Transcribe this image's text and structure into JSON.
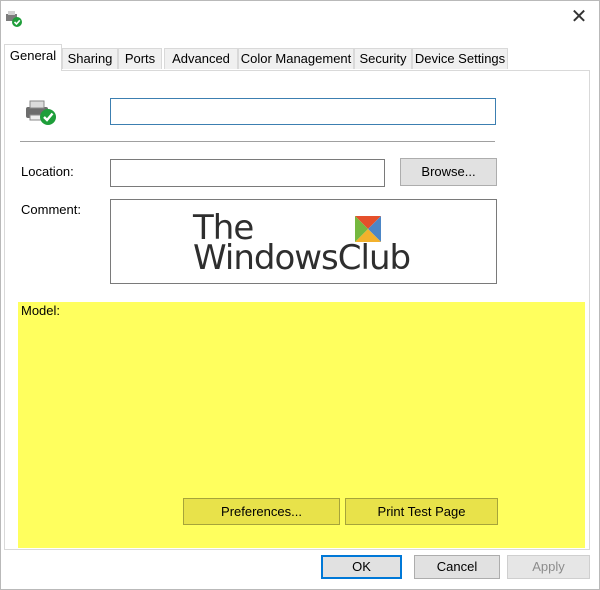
{
  "dialog": {
    "close_symbol": "✕"
  },
  "tabs": [
    {
      "label": "General",
      "active": true
    },
    {
      "label": "Sharing"
    },
    {
      "label": "Ports"
    },
    {
      "label": "Advanced"
    },
    {
      "label": "Color Management"
    },
    {
      "label": "Security"
    },
    {
      "label": "Device Settings"
    }
  ],
  "general": {
    "printer_name_value": "",
    "location_label": "Location:",
    "location_value": "",
    "browse_label": "Browse...",
    "comment_label": "Comment:",
    "comment_logo_line1": "The",
    "comment_logo_line2": "WindowsClub",
    "model_label": "Model:",
    "highlight_color": "#ffff5e",
    "preferences_label": "Preferences...",
    "print_test_label": "Print Test Page"
  },
  "footer": {
    "ok_label": "OK",
    "cancel_label": "Cancel",
    "apply_label": "Apply",
    "accent_color": "#0078d7"
  },
  "icons": [
    "printer-check-icon",
    "close-icon",
    "windows-club-logo-icon"
  ]
}
